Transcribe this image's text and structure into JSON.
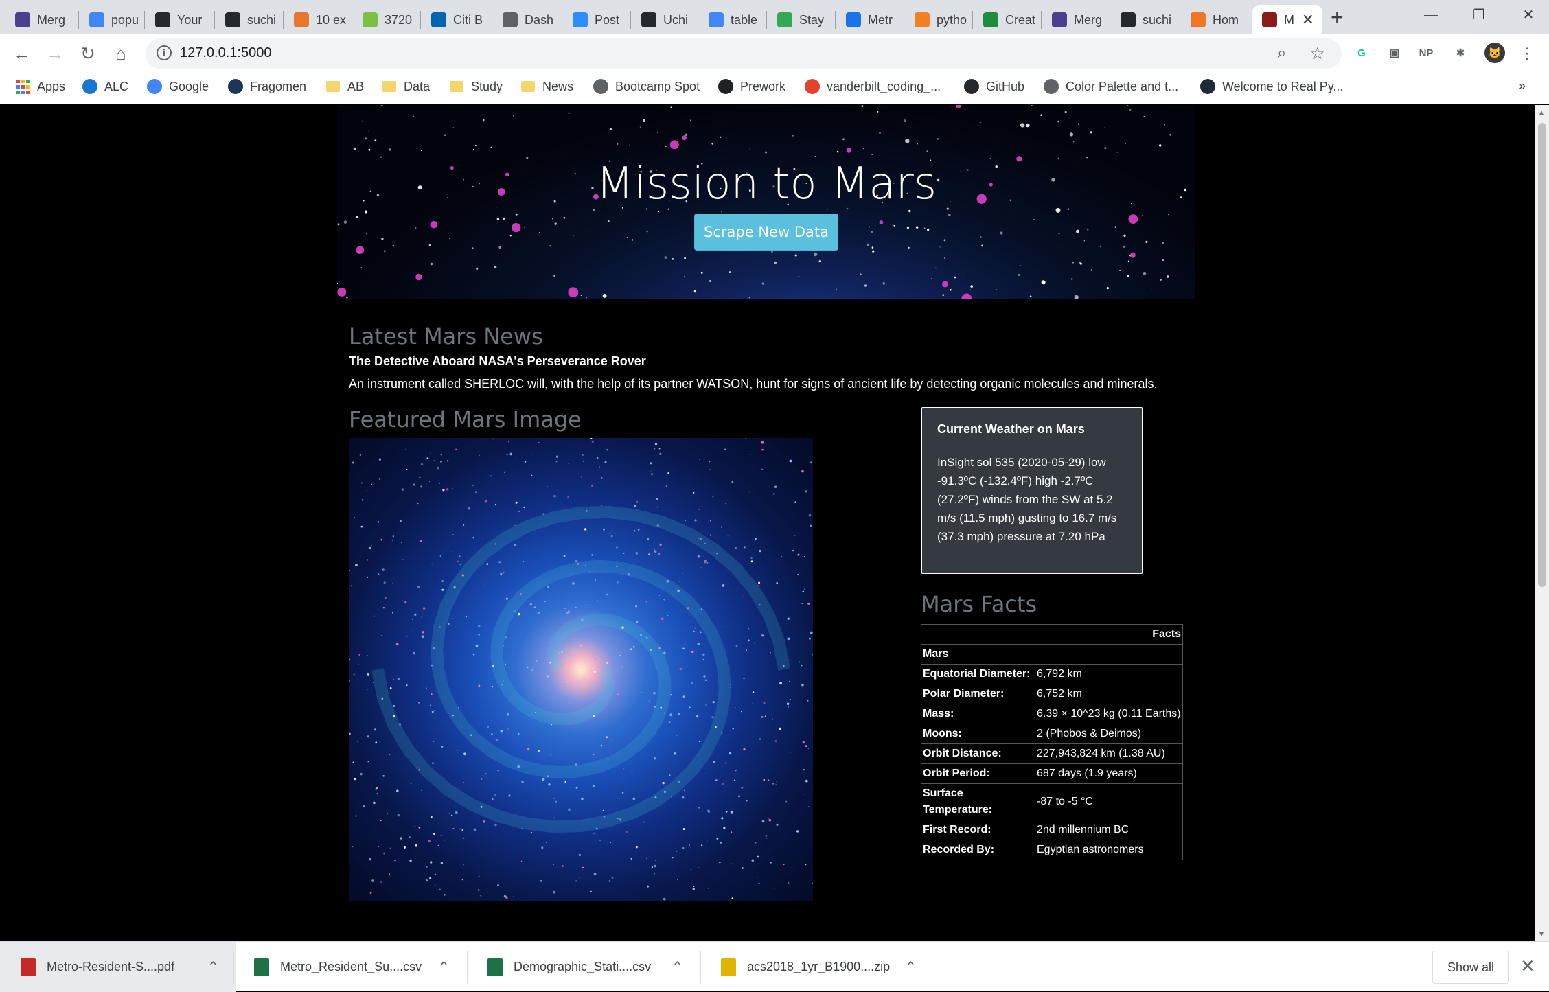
{
  "browser": {
    "tabs": [
      {
        "label": "Merg",
        "icon": "dashboard-icon",
        "color": "#4b3f8f"
      },
      {
        "label": "popu",
        "icon": "google-icon",
        "color": "#4285f4"
      },
      {
        "label": "Your",
        "icon": "github-icon",
        "color": "#24292e"
      },
      {
        "label": "suchi",
        "icon": "github-icon",
        "color": "#24292e"
      },
      {
        "label": "10 ex",
        "icon": "tableau-icon",
        "color": "#e8762d"
      },
      {
        "label": "3720",
        "icon": "zillow-icon",
        "color": "#7cc043"
      },
      {
        "label": "Citi B",
        "icon": "citi-bike-icon",
        "color": "#0066b2"
      },
      {
        "label": "Dash",
        "icon": "globe-icon",
        "color": "#5f6368"
      },
      {
        "label": "Post",
        "icon": "zoom-icon",
        "color": "#2d8cff"
      },
      {
        "label": "Uchi",
        "icon": "github-icon",
        "color": "#24292e"
      },
      {
        "label": "table",
        "icon": "google-icon",
        "color": "#4285f4"
      },
      {
        "label": "Stay",
        "icon": "maps-pin-icon",
        "color": "#34a853"
      },
      {
        "label": "Metr",
        "icon": "metro-icon",
        "color": "#1a73e8"
      },
      {
        "label": "pytho",
        "icon": "stackoverflow-icon",
        "color": "#f48024"
      },
      {
        "label": "Creat",
        "icon": "dg-icon",
        "color": "#1e8e3e"
      },
      {
        "label": "Merg",
        "icon": "dashboard-icon",
        "color": "#4b3f8f"
      },
      {
        "label": "suchi",
        "icon": "github-icon",
        "color": "#24292e"
      },
      {
        "label": "Hom",
        "icon": "jupyter-icon",
        "color": "#f37626"
      },
      {
        "label": "M",
        "icon": "mars-icon",
        "color": "#8b1a1a"
      }
    ],
    "new_tab": "+",
    "window": {
      "minimize": "—",
      "restore": "❐",
      "close": "✕"
    },
    "url": "127.0.0.1:5000",
    "extensions": [
      {
        "label": "G",
        "color": "#15c39a",
        "icon": "grammarly-icon"
      },
      {
        "label": "▣",
        "color": "#5f6368",
        "icon": "cast-icon"
      },
      {
        "label": "NP",
        "color": "#5f6368",
        "icon": "np-icon"
      },
      {
        "label": "✱",
        "color": "#5f6368",
        "icon": "extensions-puzzle-icon"
      }
    ],
    "bookmarks": [
      {
        "label": "Apps",
        "icon": "apps-grid-icon",
        "kind": "apps"
      },
      {
        "label": "ALC",
        "icon": "alc-icon",
        "kind": "site",
        "color": "#1976d2"
      },
      {
        "label": "Google",
        "icon": "google-icon",
        "kind": "site",
        "color": "#4285f4"
      },
      {
        "label": "Fragomen",
        "icon": "fragomen-icon",
        "kind": "site",
        "color": "#1d3557"
      },
      {
        "label": "AB",
        "icon": "folder-icon",
        "kind": "folder"
      },
      {
        "label": "Data",
        "icon": "folder-icon",
        "kind": "folder"
      },
      {
        "label": "Study",
        "icon": "folder-icon",
        "kind": "folder"
      },
      {
        "label": "News",
        "icon": "folder-icon",
        "kind": "folder"
      },
      {
        "label": "Bootcamp Spot",
        "icon": "globe-icon",
        "kind": "site",
        "color": "#5f6368"
      },
      {
        "label": "Prework",
        "icon": "book-icon",
        "kind": "site",
        "color": "#202124"
      },
      {
        "label": "vanderbilt_coding_...",
        "icon": "gitlab-icon",
        "kind": "site",
        "color": "#e24329"
      },
      {
        "label": "GitHub",
        "icon": "github-icon",
        "kind": "site",
        "color": "#24292e"
      },
      {
        "label": "Color Palette and t...",
        "icon": "globe-icon",
        "kind": "site",
        "color": "#5f6368"
      },
      {
        "label": "Welcome to Real Py...",
        "icon": "realpython-icon",
        "kind": "site",
        "color": "#1f2937"
      }
    ],
    "bookmarks_overflow": "»"
  },
  "page": {
    "title": "Mission to Mars",
    "scrape_button": "Scrape New Data",
    "news": {
      "heading": "Latest Mars News",
      "title": "The Detective Aboard NASA's Perseverance Rover",
      "paragraph": "An instrument called SHERLOC will, with the help of its partner WATSON, hunt for signs of ancient life by detecting organic molecules and minerals."
    },
    "featured_heading": "Featured Mars Image",
    "weather": {
      "heading": "Current Weather on Mars",
      "text": "InSight sol 535 (2020-05-29) low -91.3ºC (-132.4ºF) high -2.7ºC (27.2ºF) winds from the SW at 5.2 m/s (11.5 mph) gusting to 16.7 m/s (37.3 mph) pressure at 7.20 hPa"
    },
    "facts": {
      "heading": "Mars Facts",
      "column_header": "Facts",
      "index_name": "Mars",
      "rows": [
        {
          "key": "Equatorial Diameter:",
          "value": "6,792 km"
        },
        {
          "key": "Polar Diameter:",
          "value": "6,752 km"
        },
        {
          "key": "Mass:",
          "value": "6.39 × 10^23 kg (0.11 Earths)"
        },
        {
          "key": "Moons:",
          "value": "2 (Phobos & Deimos)"
        },
        {
          "key": "Orbit Distance:",
          "value": "227,943,824 km (1.38 AU)"
        },
        {
          "key": "Orbit Period:",
          "value": "687 days (1.9 years)"
        },
        {
          "key": "Surface Temperature:",
          "value": "-87 to -5 °C"
        },
        {
          "key": "First Record:",
          "value": "2nd millennium BC"
        },
        {
          "key": "Recorded By:",
          "value": "Egyptian astronomers"
        }
      ]
    }
  },
  "downloads": {
    "items": [
      {
        "name": "Metro-Resident-S....pdf",
        "icon": "pdf-file-icon",
        "color": "#c62828"
      },
      {
        "name": "Metro_Resident_Su....csv",
        "icon": "excel-file-icon",
        "color": "#1e7145"
      },
      {
        "name": "Demographic_Stati....csv",
        "icon": "excel-file-icon",
        "color": "#1e7145"
      },
      {
        "name": "acs2018_1yr_B1900....zip",
        "icon": "zip-file-icon",
        "color": "#e0b400"
      }
    ],
    "show_all": "Show all",
    "close": "✕"
  }
}
